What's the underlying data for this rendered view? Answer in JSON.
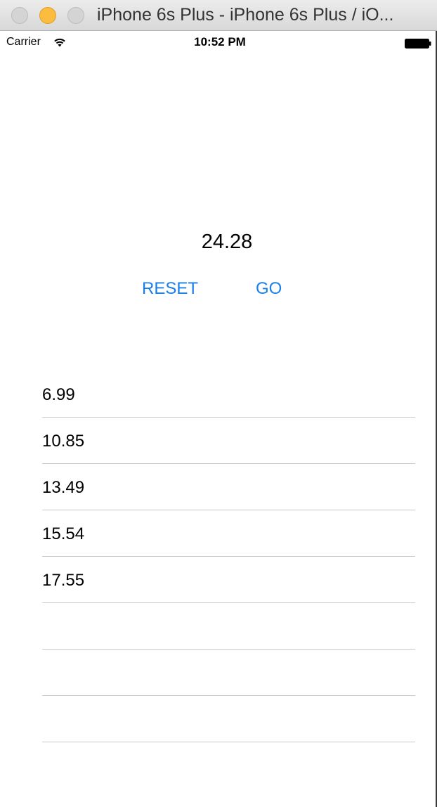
{
  "window": {
    "title": "iPhone 6s Plus - iPhone 6s Plus / iO..."
  },
  "status_bar": {
    "carrier": "Carrier",
    "time": "10:52 PM",
    "wifi_icon": "wifi-icon",
    "battery_icon": "battery-full-icon"
  },
  "timer": {
    "value": "24.28"
  },
  "controls": {
    "reset_label": "RESET",
    "go_label": "GO",
    "accent_color": "#1a7fe6"
  },
  "laps": [
    {
      "time": "6.99"
    },
    {
      "time": "10.85"
    },
    {
      "time": "13.49"
    },
    {
      "time": "15.54"
    },
    {
      "time": "17.55"
    },
    {
      "time": ""
    },
    {
      "time": ""
    },
    {
      "time": ""
    }
  ]
}
